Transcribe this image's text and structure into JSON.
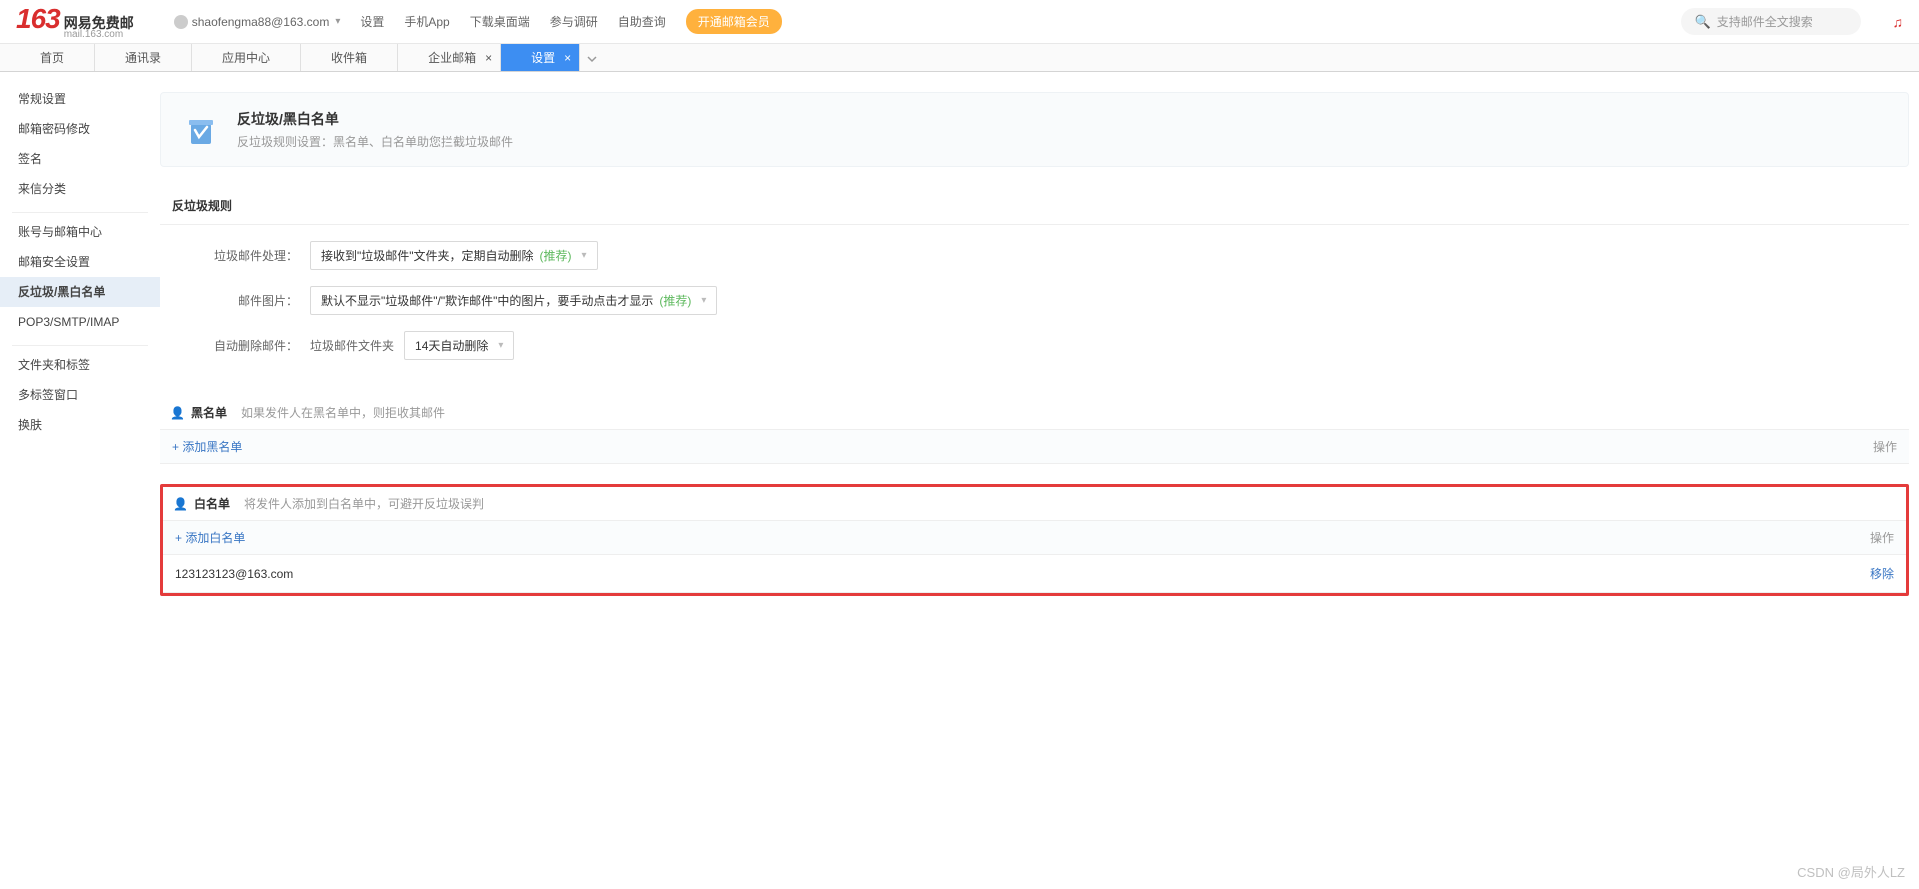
{
  "header": {
    "logo_num": "163",
    "logo_cn": "网易免费邮",
    "logo_en": "mail.163.com",
    "user_email": "shaofengma88@163.com",
    "links": [
      "设置",
      "手机App",
      "下载桌面端",
      "参与调研",
      "自助查询"
    ],
    "vip_btn": "开通邮箱会员",
    "search_placeholder": "支持邮件全文搜索"
  },
  "tabs": [
    {
      "label": "首页",
      "closable": false
    },
    {
      "label": "通讯录",
      "closable": false
    },
    {
      "label": "应用中心",
      "closable": false
    },
    {
      "label": "收件箱",
      "closable": false
    },
    {
      "label": "企业邮箱",
      "closable": true
    },
    {
      "label": "设置",
      "closable": true,
      "active": true
    }
  ],
  "sidebar": {
    "groups": [
      [
        "常规设置",
        "邮箱密码修改",
        "签名",
        "来信分类"
      ],
      [
        "账号与邮箱中心",
        "邮箱安全设置",
        "反垃圾/黑白名单",
        "POP3/SMTP/IMAP"
      ],
      [
        "文件夹和标签",
        "多标签窗口",
        "换肤"
      ]
    ],
    "active": "反垃圾/黑白名单"
  },
  "content": {
    "page_title": "反垃圾/黑白名单",
    "page_desc": "反垃圾规则设置：黑名单、白名单助您拦截垃圾邮件",
    "rules_title": "反垃圾规则",
    "rows": {
      "spam_handle": {
        "label": "垃圾邮件处理：",
        "value": "接收到\"垃圾邮件\"文件夹，定期自动删除",
        "recommend": "(推荐)"
      },
      "mail_image": {
        "label": "邮件图片：",
        "value": "默认不显示\"垃圾邮件\"/\"欺诈邮件\"中的图片，要手动点击才显示",
        "recommend": "(推荐)"
      },
      "auto_delete": {
        "label": "自动删除邮件：",
        "static": "垃圾邮件文件夹",
        "value": "14天自动删除"
      }
    },
    "blacklist": {
      "title": "黑名单",
      "desc": "如果发件人在黑名单中，则拒收其邮件",
      "add_label": "+ 添加黑名单",
      "action_header": "操作"
    },
    "whitelist": {
      "title": "白名单",
      "desc": "将发件人添加到白名单中，可避开反垃圾误判",
      "add_label": "+ 添加白名单",
      "action_header": "操作",
      "entries": [
        {
          "email": "123123123@163.com",
          "remove": "移除"
        }
      ]
    }
  },
  "watermark": "CSDN @局外人LZ"
}
